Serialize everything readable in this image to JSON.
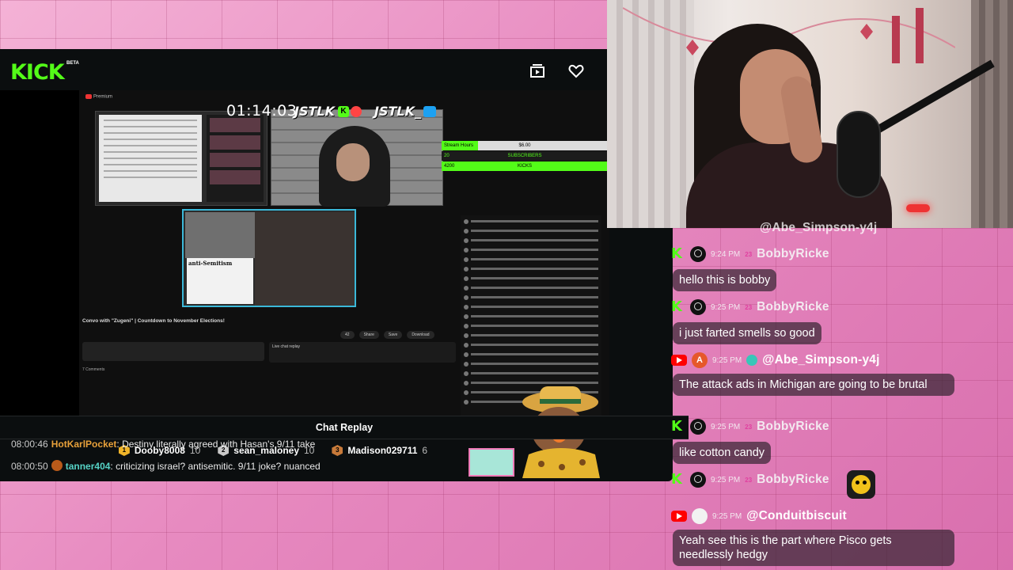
{
  "kick": {
    "logo": "KICK",
    "beta": "BETA"
  },
  "stream": {
    "timer": "01:14:03",
    "brand_a": "JSTLK",
    "brand_b": "JSTLK_",
    "yt_logo": "Premium",
    "title": "Convo with \"Zugeni\" | Countdown to November Elections!",
    "anti_label": "anti-Semitism",
    "comments": "7 Comments",
    "live_replay": "Live chat replay",
    "actions": [
      "42",
      "Share",
      "Save",
      "Download"
    ]
  },
  "goals": {
    "hours_label": "Stream Hours",
    "hours_value": "$6.00",
    "hours_fill_fraction": 0.22,
    "subs_left": "20",
    "subs_label": "SUBSCRIBERS",
    "kicks_left": "4200",
    "kicks_label": "KICKS"
  },
  "leaderboard": [
    {
      "rank": "1",
      "name": "Dooby8008",
      "count": "10",
      "color": "#f0b429"
    },
    {
      "rank": "2",
      "name": "sean_maloney",
      "count": "10",
      "color": "#c9c9c9"
    },
    {
      "rank": "3",
      "name": "Madison029711",
      "count": "6",
      "color": "#c77a3a"
    }
  ],
  "chat_replay": {
    "header": "Chat Replay",
    "lines": [
      {
        "time": "08:00:46",
        "user": "HotKarlPocket",
        "user_color": "#e8a13a",
        "text": ": Destiny literally agreed with Hasan's 9/11 take"
      },
      {
        "time": "08:00:50",
        "user": "tanner404",
        "user_color": "#56d3c6",
        "text": ": criticizing israel? antisemitic. 9/11 joke? nuanced"
      }
    ]
  },
  "right_chat": {
    "partial_top": "@Abe_Simpson-y4j",
    "messages": [
      {
        "platform": "kick",
        "time": "9:24 PM",
        "badge": "23",
        "user": "BobbyRicke",
        "text": "hello this is bobby"
      },
      {
        "platform": "kick",
        "time": "9:25 PM",
        "badge": "23",
        "user": "BobbyRicke",
        "text": "i just farted smells so good"
      },
      {
        "platform": "youtube",
        "avatar": "A",
        "time": "9:25 PM",
        "user": "@Abe_Simpson-y4j",
        "text": "The attack ads in Michigan are going to be brutal"
      },
      {
        "platform": "kick",
        "time": "9:25 PM",
        "badge": "23",
        "user": "BobbyRicke",
        "text": "like cotton candy"
      },
      {
        "platform": "kick",
        "time": "9:25 PM",
        "badge": "23",
        "user": "BobbyRicke",
        "text": ""
      },
      {
        "platform": "youtube",
        "time": "9:25 PM",
        "user": "@Conduitbiscuit",
        "text": "Yeah see this is the part where Pisco gets needlessly hedgy"
      }
    ]
  },
  "colors": {
    "kick_green": "#53fc18",
    "panel_bg": "#0b0e0f",
    "pink_bg": "#e78dbd"
  }
}
